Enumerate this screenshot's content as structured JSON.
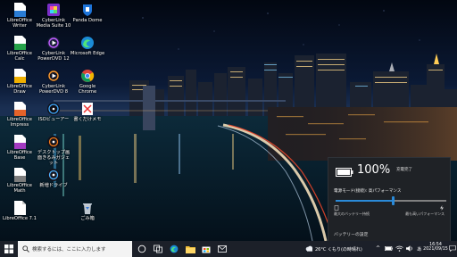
{
  "desktop": {
    "icons": [
      {
        "label": "LibreOffice Writer",
        "icon": "writer-icon"
      },
      {
        "label": "CyberLink Media Suite 10",
        "icon": "cyberlink-media-suite-icon"
      },
      {
        "label": "Panda Dome",
        "icon": "panda-dome-icon"
      },
      {
        "label": "LibreOffice Calc",
        "icon": "calc-icon"
      },
      {
        "label": "CyberLink PowerDVD 12",
        "icon": "powerdvd-icon"
      },
      {
        "label": "Microsoft Edge",
        "icon": "edge-icon"
      },
      {
        "label": "LibreOffice Draw",
        "icon": "draw-icon"
      },
      {
        "label": "CyberLink PowerDVD 8",
        "icon": "powerdvd8-icon"
      },
      {
        "label": "Google Chrome",
        "icon": "chrome-icon"
      },
      {
        "label": "LibreOffice Impress",
        "icon": "impress-icon"
      },
      {
        "label": "ISOビューアー",
        "icon": "iso-viewer-icon"
      },
      {
        "label": "書くだけメモ",
        "icon": "memo-icon"
      },
      {
        "label": "LibreOffice Base",
        "icon": "base-icon"
      },
      {
        "label": "デスクトップ画面きるみガジェット",
        "icon": "gadget-icon"
      },
      {
        "label": "LibreOffice Math",
        "icon": "math-icon"
      },
      {
        "label": "新増ドライブ",
        "icon": "drive-icon"
      },
      {
        "label": "LibreOffice 7.1",
        "icon": "libreoffice-icon"
      },
      {
        "label": "ごみ箱",
        "icon": "recycle-bin-icon"
      }
    ]
  },
  "taskbar": {
    "search_placeholder": "検索するには、ここに入力します",
    "weather": "26°C くもり(の時晴れ)",
    "ime": "あ",
    "time": "16:54",
    "date": "2021/09/15"
  },
  "battery_flyout": {
    "percent": "100%",
    "status": "充電完了",
    "mode_label": "電源モード(接続): 高パフォーマンス",
    "slider_level": 0.52,
    "left_label": "最大のバッテリー持続",
    "right_label": "最も高いパフォーマンス",
    "settings_link": "バッテリーの設定"
  },
  "colors": {
    "accent": "#2a8ad8",
    "taskbar": "#1c2029",
    "flyout": "#1f2226"
  }
}
